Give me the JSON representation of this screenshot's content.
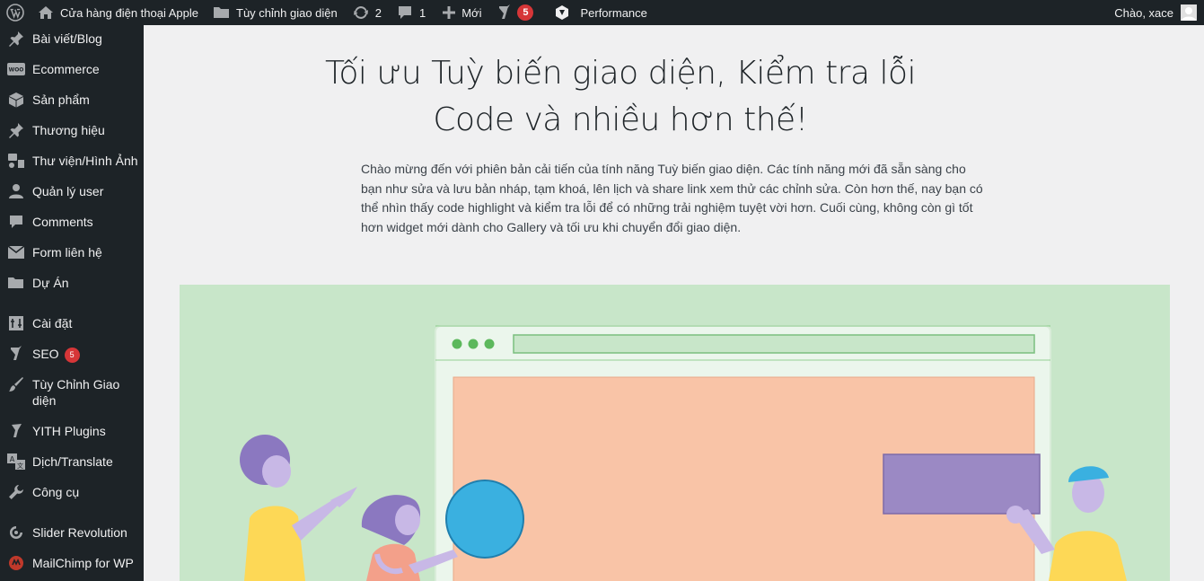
{
  "adminbar": {
    "site_name": "Cửa hàng điện thoại Apple",
    "customize": "Tùy chỉnh giao diện",
    "updates_count": "2",
    "comments_count": "1",
    "new_label": "Mới",
    "seo_count": "5",
    "performance": "Performance",
    "greeting": "Chào, xace"
  },
  "sidebar": {
    "items": [
      {
        "label": "Bài viết/Blog",
        "icon": "pin-icon"
      },
      {
        "label": "Ecommerce",
        "icon": "woo-icon"
      },
      {
        "label": "Sản phẩm",
        "icon": "box-icon"
      },
      {
        "label": "Thương hiệu",
        "icon": "pin-icon"
      },
      {
        "label": "Thư viện/Hình Ảnh",
        "icon": "media-icon"
      },
      {
        "label": "Quản lý user",
        "icon": "user-icon"
      },
      {
        "label": "Comments",
        "icon": "comment-icon"
      },
      {
        "label": "Form liên hệ",
        "icon": "mail-icon"
      },
      {
        "label": "Dự Án",
        "icon": "folder-icon"
      },
      {
        "label": "Cài đặt",
        "icon": "settings-icon"
      },
      {
        "label": "SEO",
        "icon": "yoast-icon",
        "badge": "5"
      },
      {
        "label": "Tùy Chỉnh Giao diện",
        "icon": "brush-icon"
      },
      {
        "label": "YITH Plugins",
        "icon": "yith-icon"
      },
      {
        "label": "Dịch/Translate",
        "icon": "translate-icon"
      },
      {
        "label": "Công cụ",
        "icon": "wrench-icon"
      },
      {
        "label": "Slider Revolution",
        "icon": "refresh-icon"
      },
      {
        "label": "MailChimp for WP",
        "icon": "mailchimp-icon"
      }
    ]
  },
  "main": {
    "headline": "Tối ưu Tuỳ biến giao diện, Kiểm tra lỗi Code và nhiều hơn thế!",
    "intro": "Chào mừng đến với phiên bản cải tiến của tính năng Tuỳ biến giao diện. Các tính năng mới đã sẵn sàng cho bạn như sửa và lưu bản nháp, tạm khoá, lên lịch và share link xem thử các chỉnh sửa. Còn hơn thế, nay bạn có thể nhìn thấy code highlight và kiểm tra lỗi để có những trải nghiệm tuyệt vời hơn. Cuối cùng, không còn gì tốt hơn widget mới dành cho Gallery và tối ưu khi chuyển đổi giao diện."
  },
  "colors": {
    "adminbar_bg": "#1d2327",
    "hero_bg": "#c8e6c9",
    "canvas": "#f9c4a7",
    "badge": "#d63638"
  }
}
